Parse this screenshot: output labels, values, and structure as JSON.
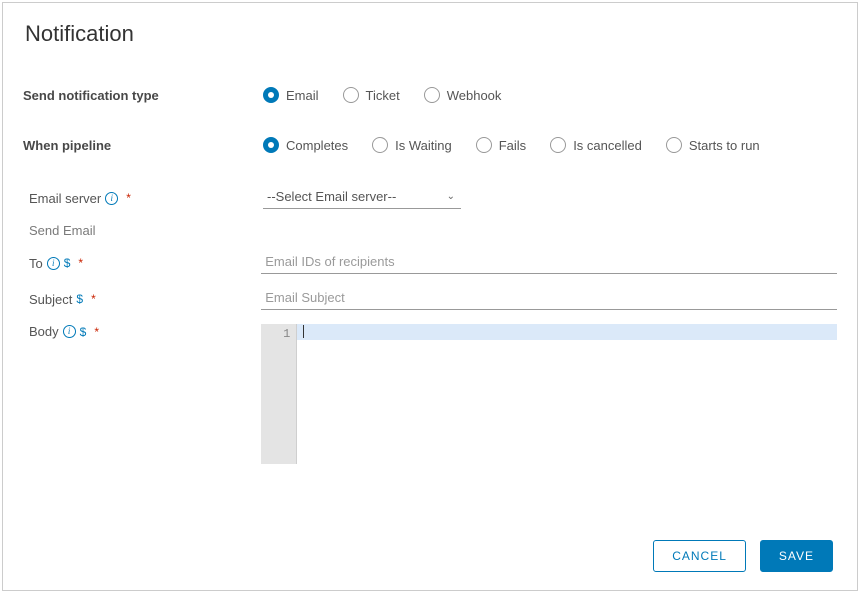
{
  "title": "Notification",
  "notificationType": {
    "label": "Send notification type",
    "options": [
      {
        "label": "Email",
        "selected": true
      },
      {
        "label": "Ticket",
        "selected": false
      },
      {
        "label": "Webhook",
        "selected": false
      }
    ]
  },
  "whenPipeline": {
    "label": "When pipeline",
    "options": [
      {
        "label": "Completes",
        "selected": true
      },
      {
        "label": "Is Waiting",
        "selected": false
      },
      {
        "label": "Fails",
        "selected": false
      },
      {
        "label": "Is cancelled",
        "selected": false
      },
      {
        "label": "Starts to run",
        "selected": false
      }
    ]
  },
  "emailServer": {
    "label": "Email server",
    "placeholder": "--Select Email server--",
    "required": true
  },
  "sendEmail": {
    "heading": "Send Email",
    "to": {
      "label": "To",
      "placeholder": "Email IDs of recipients",
      "required": true
    },
    "subject": {
      "label": "Subject",
      "placeholder": "Email Subject",
      "required": true
    },
    "body": {
      "label": "Body",
      "required": true,
      "lineNumber": "1"
    }
  },
  "buttons": {
    "cancel": "CANCEL",
    "save": "SAVE"
  }
}
